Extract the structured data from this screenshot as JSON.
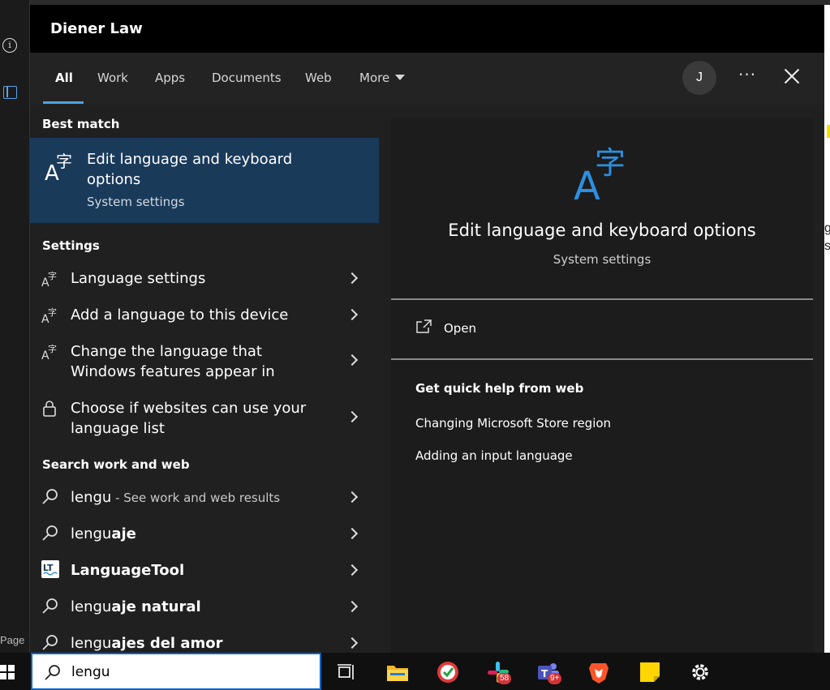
{
  "window": {
    "org_name": "Diener Law"
  },
  "background": {
    "page_label": "Page",
    "right_letters": "g\ns"
  },
  "tabs": [
    {
      "label": "All",
      "active": true
    },
    {
      "label": "Work"
    },
    {
      "label": "Apps"
    },
    {
      "label": "Documents"
    },
    {
      "label": "Web"
    },
    {
      "label": "More"
    }
  ],
  "header": {
    "avatar_initial": "J",
    "more_options": "···"
  },
  "best_match": {
    "section_title": "Best match",
    "title": "Edit language and keyboard options",
    "subtitle": "System settings"
  },
  "settings": {
    "section_title": "Settings",
    "items": [
      {
        "label": "Language settings",
        "icon": "language-icon"
      },
      {
        "label": "Add a language to this device",
        "icon": "language-icon"
      },
      {
        "label": "Change the language that Windows features appear in",
        "icon": "language-icon"
      },
      {
        "label": "Choose if websites can use your language list",
        "icon": "lock-icon"
      }
    ]
  },
  "web": {
    "section_title": "Search work and web",
    "items": [
      {
        "prefix": "lengu",
        "suffix": "",
        "hint": " - See work and web results",
        "icon": "search-icon"
      },
      {
        "prefix": "lengu",
        "suffix": "aje",
        "hint": "",
        "icon": "search-icon"
      },
      {
        "prefix": "",
        "suffix": "LanguageTool",
        "hint": "",
        "icon": "languagetool-icon"
      },
      {
        "prefix": "lengu",
        "suffix": "aje natural",
        "hint": "",
        "icon": "search-icon"
      },
      {
        "prefix": "lengu",
        "suffix": "ajes del amor",
        "hint": "",
        "icon": "search-icon"
      }
    ]
  },
  "preview": {
    "title": "Edit language and keyboard options",
    "subtitle": "System settings",
    "open_label": "Open",
    "help_title": "Get quick help from web",
    "help_links": [
      "Changing Microsoft Store region",
      "Adding an input language"
    ]
  },
  "taskbar": {
    "search_query": "lengu",
    "slack_badge": "58",
    "teams_badge": "9+"
  },
  "colors": {
    "accent": "#4ba3e3",
    "best_match_bg": "#1a3a5a",
    "panel_bg": "#202020"
  }
}
